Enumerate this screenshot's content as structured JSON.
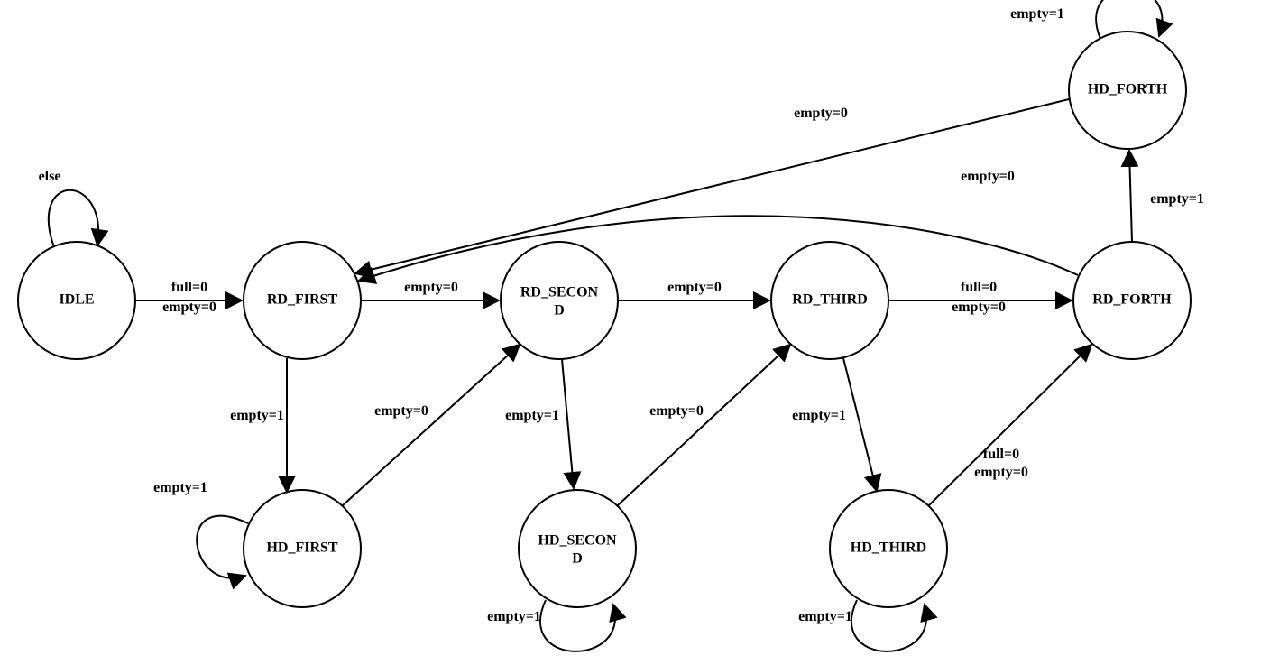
{
  "diagram": {
    "states": {
      "idle": "IDLE",
      "rd_first": "RD_FIRST",
      "rd_second_l1": "RD_SECON",
      "rd_second_l2": "D",
      "rd_third": "RD_THIRD",
      "rd_forth": "RD_FORTH",
      "hd_first": "HD_FIRST",
      "hd_second_l1": "HD_SECON",
      "hd_second_l2": "D",
      "hd_third": "HD_THIRD",
      "hd_forth": "HD_FORTH"
    },
    "labels": {
      "else": "else",
      "full0": "full=0",
      "empty0": "empty=0",
      "empty1": "empty=1"
    }
  }
}
